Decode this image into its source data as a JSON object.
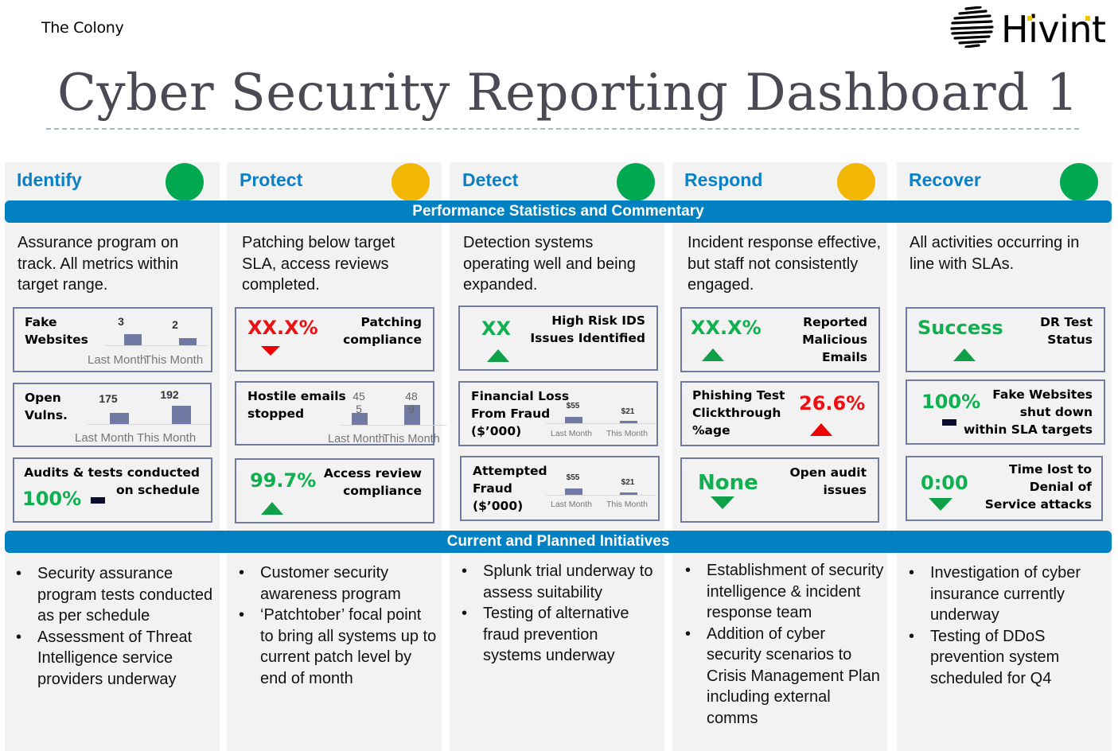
{
  "header": {
    "organization": "The Colony",
    "logo_text": "Hivint",
    "title": "Cyber Security Reporting Dashboard 1"
  },
  "colors": {
    "accent_blue": "#0281c2",
    "status_green": "#00a94f",
    "status_amber": "#f2b705",
    "good": "#10b050",
    "bad": "#ee1010"
  },
  "bars": {
    "performance": "Performance Statistics and Commentary",
    "initiatives": "Current and Planned Initiatives"
  },
  "columns": [
    {
      "name": "Identify",
      "status": "green",
      "commentary": "Assurance program on track.  All metrics within target range.",
      "initiatives": [
        "Security assurance program tests conducted as per schedule",
        "Assessment of Threat Intelligence service providers underway"
      ]
    },
    {
      "name": "Protect",
      "status": "amber",
      "commentary": "Patching below target SLA, access reviews completed.",
      "initiatives": [
        "Customer security awareness program",
        "‘Patchtober’ focal point to bring all systems up to current patch level by end of month"
      ]
    },
    {
      "name": "Detect",
      "status": "green",
      "commentary": "Detection systems operating well and being expanded.",
      "initiatives": [
        "Splunk trial underway to assess suitability",
        "Testing of alternative fraud prevention systems underway"
      ]
    },
    {
      "name": "Respond",
      "status": "amber",
      "commentary": "Incident response effective, but staff not consistently engaged.",
      "initiatives": [
        "Establishment of security intelligence & incident response team",
        "Addition of cyber security scenarios to Crisis Management Plan including external comms"
      ]
    },
    {
      "name": "Recover",
      "status": "green",
      "commentary": "All activities occurring in line with SLAs.",
      "initiatives": [
        "Investigation of cyber insurance currently underway",
        "Testing of DDoS prevention system scheduled for Q4"
      ]
    }
  ],
  "metrics": {
    "identify": {
      "fake_websites": {
        "label": "Fake Websites",
        "label_l1": "Fake",
        "label_l2": "Websites",
        "last_month": 3,
        "this_month": 2,
        "cat_last": "Last Month",
        "cat_this": "This Month"
      },
      "open_vulns": {
        "label_l1": "Open",
        "label_l2": "Vulns.",
        "last_month": 175,
        "this_month": 192,
        "cat_last": "Last Month",
        "cat_this": "This Month"
      },
      "audits": {
        "label_l1": "Audits & tests conducted",
        "label_l2": "on schedule",
        "value": "100%",
        "trend": "flat"
      }
    },
    "protect": {
      "patching": {
        "label_l1": "Patching",
        "label_l2": "compliance",
        "value": "XX.X%",
        "trend": "down",
        "rating": "bad"
      },
      "hostile_emails": {
        "label_l1": "Hostile emails",
        "label_l2": "stopped",
        "last_month": 455,
        "this_month": 489,
        "last_l1": "45",
        "last_l2": "5",
        "this_l1": "48",
        "this_l2": "9",
        "cat_last": "Last Month",
        "cat_this": "This Month"
      },
      "access_review": {
        "label_l1": "Access review",
        "label_l2": "compliance",
        "value": "99.7%",
        "trend": "up",
        "rating": "good"
      }
    },
    "detect": {
      "ids": {
        "label_l1": "High Risk IDS",
        "label_l2": "Issues Identified",
        "value": "XX",
        "trend": "up",
        "rating": "good"
      },
      "financial_loss": {
        "label_l1": "Financial Loss",
        "label_l2": "From Fraud",
        "label_l3": "($’000)",
        "last_month": 55,
        "this_month": 21,
        "last_label": "$55",
        "this_label": "$21",
        "cat_last": "Last Month",
        "cat_this": "This Month"
      },
      "attempted_fraud": {
        "label_l1": "Attempted",
        "label_l2": "Fraud",
        "label_l3": "($’000)",
        "last_month": 55,
        "this_month": 21,
        "last_label": "$55",
        "this_label": "$21",
        "cat_last": "Last Month",
        "cat_this": "This Month"
      }
    },
    "respond": {
      "reported_malicious": {
        "label_l1": "Reported",
        "label_l2": "Malicious",
        "label_l3": "Emails",
        "value": "XX.X%",
        "trend": "up",
        "rating": "good"
      },
      "phishing": {
        "label_l1": "Phishing Test",
        "label_l2": "Clickthrough",
        "label_l3": "%age",
        "value": "26.6%",
        "trend": "up",
        "rating": "bad"
      },
      "audit_issues": {
        "label_l1": "Open audit",
        "label_l2": "issues",
        "value": "None",
        "trend": "down",
        "rating": "good"
      }
    },
    "recover": {
      "dr_test": {
        "label_l1": "DR Test",
        "label_l2": "Status",
        "value": "Success",
        "trend": "up",
        "rating": "good"
      },
      "fake_sites_shutdown": {
        "label_l1": "Fake Websites",
        "label_l2": "shut down",
        "label_l3": "within SLA targets",
        "value": "100%",
        "trend": "flat",
        "rating": "good"
      },
      "dos_time": {
        "label_l1": "Time lost to",
        "label_l2": "Denial of",
        "label_l3": "Service attacks",
        "value": "0:00",
        "trend": "down",
        "rating": "good"
      }
    }
  }
}
